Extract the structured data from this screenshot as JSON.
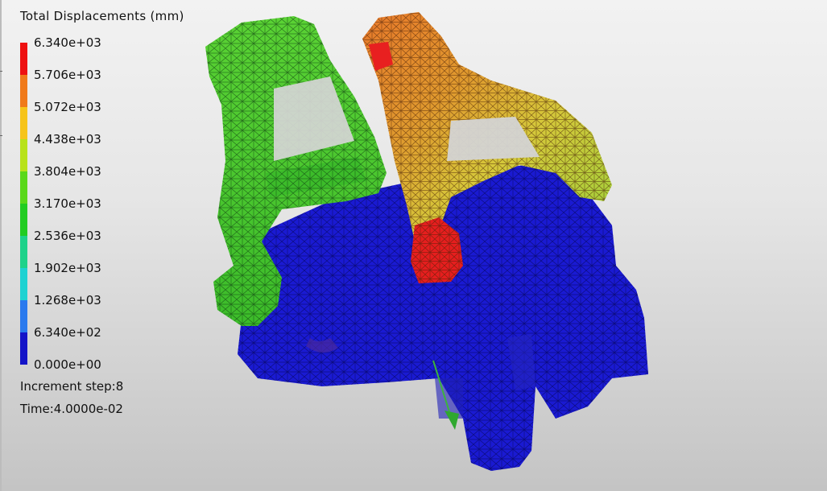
{
  "legend": {
    "title": "Total Displacements (mm)",
    "labels": [
      "6.340e+03",
      "5.706e+03",
      "5.072e+03",
      "4.438e+03",
      "3.804e+03",
      "3.170e+03",
      "2.536e+03",
      "1.902e+03",
      "1.268e+03",
      "6.340e+02",
      "0.000e+00"
    ],
    "colors": [
      "#ee1111",
      "#f07a1a",
      "#f6c41a",
      "#b8e21a",
      "#5ad81a",
      "#22cc22",
      "#1ed28a",
      "#1ed2d2",
      "#2a7aee",
      "#1414c8"
    ]
  },
  "info": {
    "increment": "Increment step:8",
    "time": "Time:4.0000e-02"
  },
  "model": {
    "colors": {
      "blue": "#1a1ad2",
      "green": "#4cc82a",
      "light_green": "#7ad43a",
      "yellow": "#d8d83a",
      "orange": "#e8822c",
      "red": "#e82020",
      "mesh": "#0a0a30",
      "arrow": "#3cb43c"
    }
  }
}
